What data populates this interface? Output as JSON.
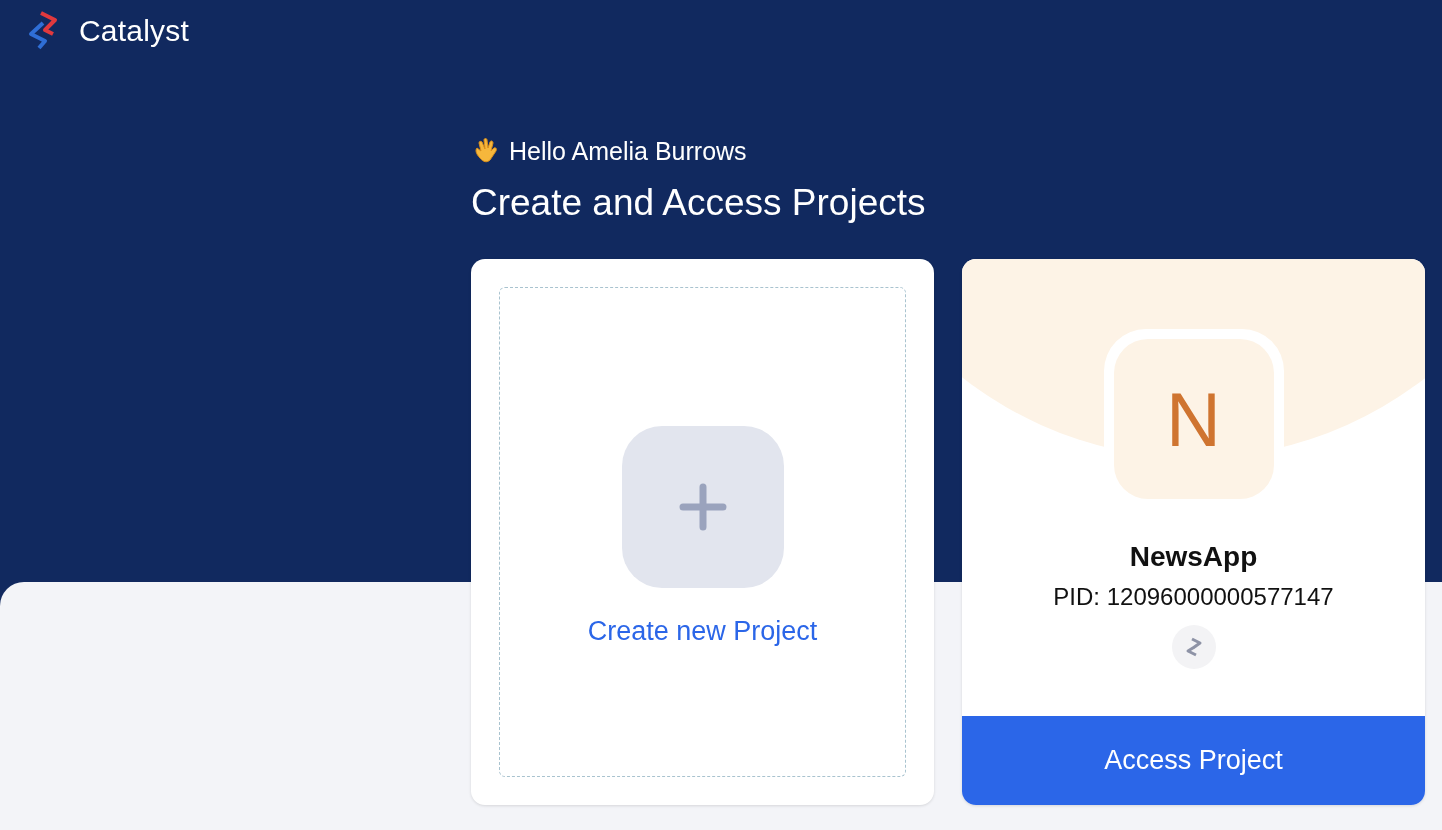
{
  "header": {
    "brand": "Catalyst"
  },
  "greeting": "Hello Amelia Burrows",
  "heading": "Create and Access Projects",
  "create_card": {
    "label": "Create new Project"
  },
  "projects": [
    {
      "initial": "N",
      "name": "NewsApp",
      "pid": "PID: 12096000000577147",
      "action": "Access Project"
    }
  ]
}
